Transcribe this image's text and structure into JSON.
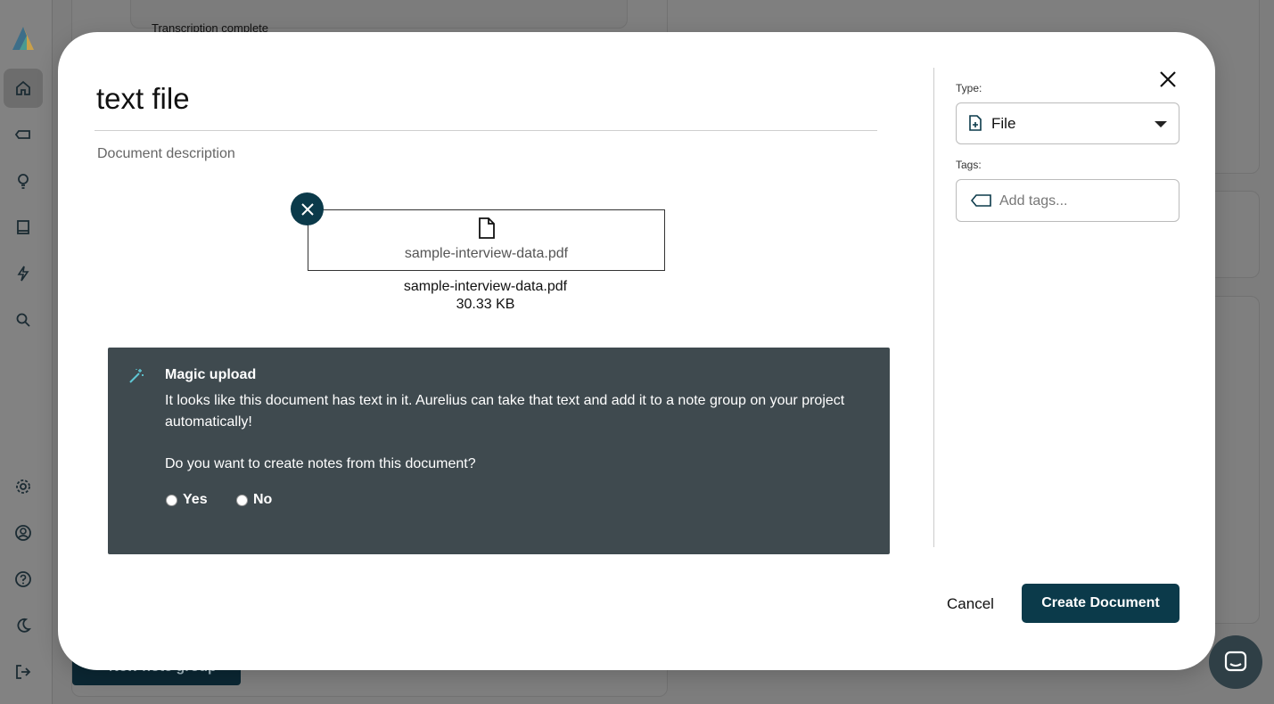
{
  "background": {
    "status_text": "Transcription complete",
    "new_button_label": "+ New note group"
  },
  "sidebar": {
    "items": [
      {
        "name": "home-icon",
        "active": true
      },
      {
        "name": "tag-icon",
        "active": false
      },
      {
        "name": "lightbulb-icon",
        "active": false
      },
      {
        "name": "book-icon",
        "active": false
      },
      {
        "name": "lightning-icon",
        "active": false
      },
      {
        "name": "search-icon",
        "active": false
      },
      {
        "name": "gear-icon",
        "active": false
      },
      {
        "name": "user-icon",
        "active": false
      },
      {
        "name": "help-icon",
        "active": false
      },
      {
        "name": "moon-icon",
        "active": false
      },
      {
        "name": "logout-icon",
        "active": false
      }
    ]
  },
  "modal": {
    "title": "text file",
    "description_placeholder": "Document description",
    "file": {
      "box_name": "sample-interview-data.pdf",
      "name": "sample-interview-data.pdf",
      "size": "30.33 KB"
    },
    "magic_upload": {
      "title": "Magic upload",
      "body": "It looks like this document has text in it. Aurelius can take that text and add it to a note group on your project automatically!",
      "question": "Do you want to create notes from this document?",
      "yes_label": "Yes",
      "no_label": "No"
    },
    "type_label": "Type:",
    "type_value": "File",
    "tags_label": "Tags:",
    "tags_placeholder": "Add tags...",
    "cancel_label": "Cancel",
    "create_label": "Create Document"
  },
  "colors": {
    "primary": "#0b3a4a",
    "magic_bg": "#3f4a4f",
    "accent_teal": "#5fc6d3"
  }
}
